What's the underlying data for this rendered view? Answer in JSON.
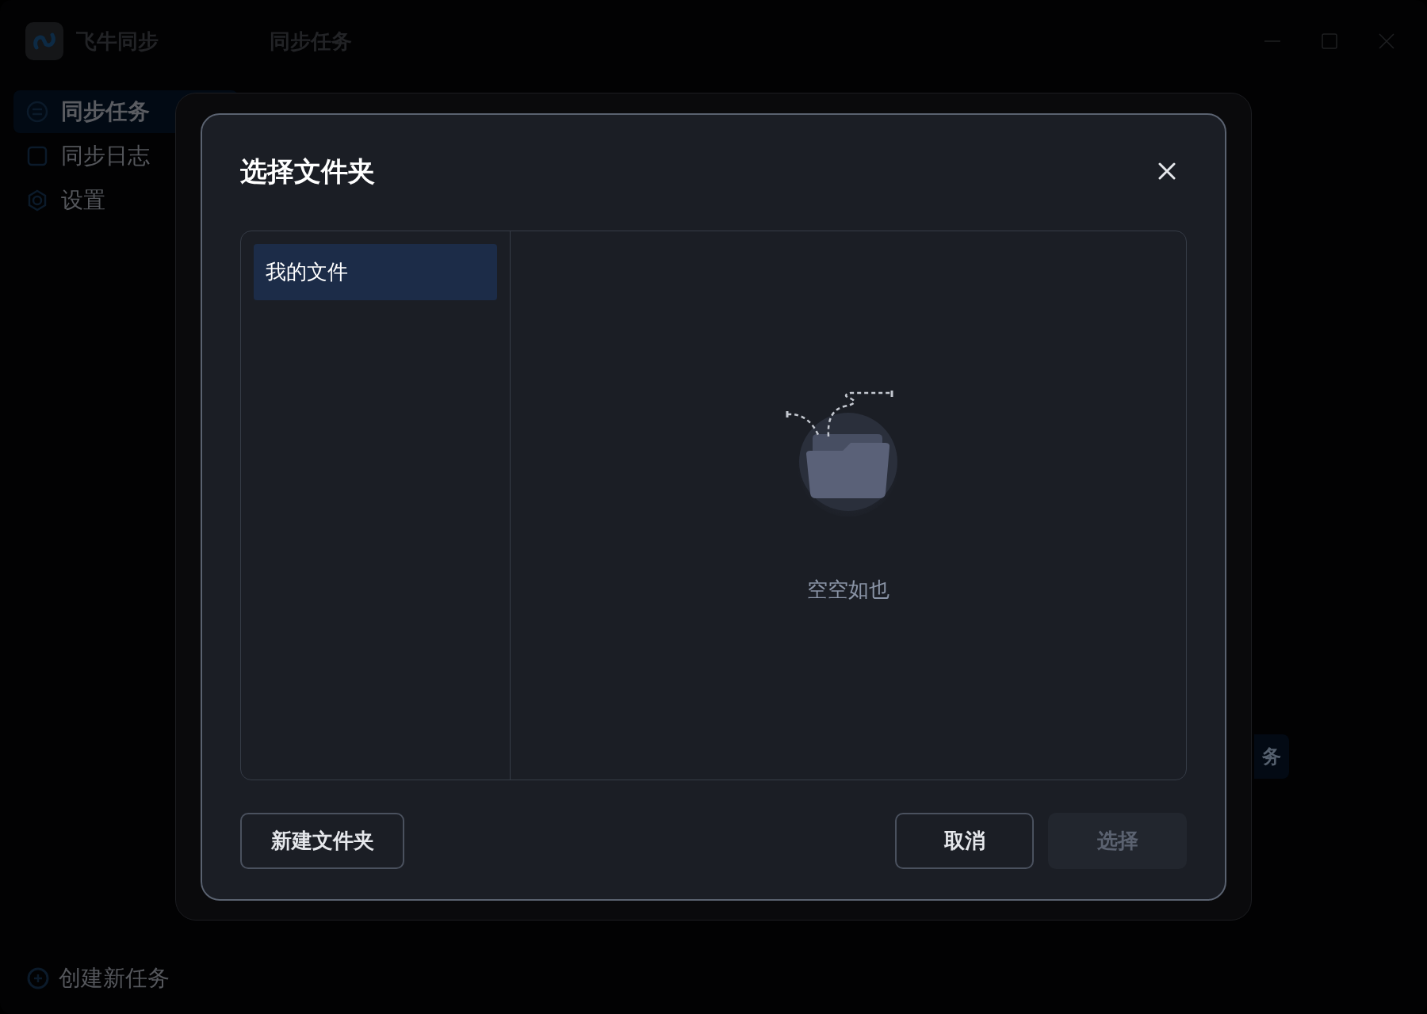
{
  "app": {
    "name": "飞牛同步",
    "page_title": "同步任务"
  },
  "sidebar": {
    "items": [
      {
        "label": "同步任务",
        "selected": true
      },
      {
        "label": "同步日志",
        "selected": false
      },
      {
        "label": "设置",
        "selected": false
      }
    ],
    "create_button": "创建新任务"
  },
  "background_button": "务",
  "dialog": {
    "title": "选择文件夹",
    "locations": [
      {
        "label": "我的文件",
        "selected": true
      }
    ],
    "empty_text": "空空如也",
    "buttons": [
      {
        "label": "新建文件夹",
        "kind": "outline",
        "disabled": false
      },
      {
        "label": "取消",
        "kind": "outline",
        "disabled": false
      },
      {
        "label": "选择",
        "kind": "primary",
        "disabled": true
      }
    ]
  }
}
